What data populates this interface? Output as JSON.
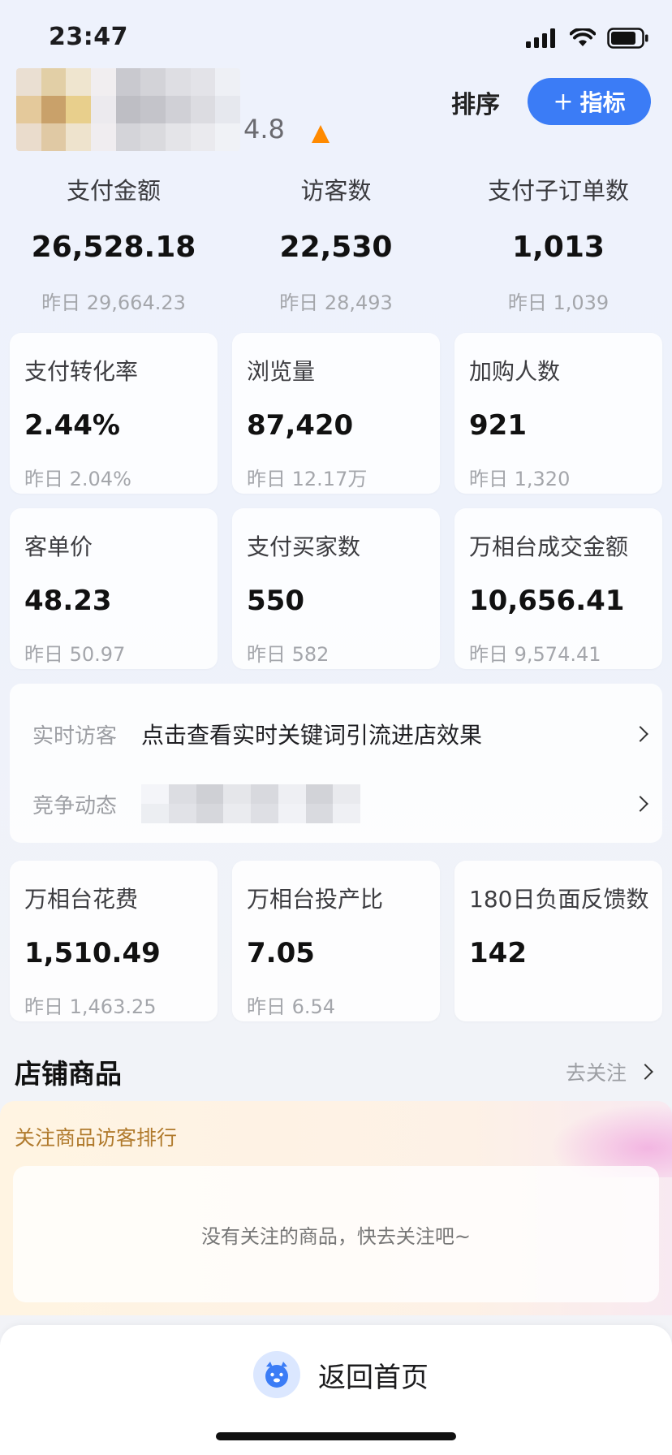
{
  "status_bar": {
    "time": "23:47"
  },
  "header": {
    "rating_suffix": "4.8",
    "sort_label": "排序",
    "metric_label": "指标"
  },
  "top_metrics": [
    {
      "label": "支付金额",
      "value": "26,528.18",
      "prev": "昨日 29,664.23"
    },
    {
      "label": "访客数",
      "value": "22,530",
      "prev": "昨日 28,493"
    },
    {
      "label": "支付子订单数",
      "value": "1,013",
      "prev": "昨日 1,039"
    }
  ],
  "cards": [
    {
      "label": "支付转化率",
      "value": "2.44%",
      "prev": "昨日 2.04%"
    },
    {
      "label": "浏览量",
      "value": "87,420",
      "prev": "昨日 12.17万"
    },
    {
      "label": "加购人数",
      "value": "921",
      "prev": "昨日 1,320"
    },
    {
      "label": "客单价",
      "value": "48.23",
      "prev": "昨日 50.97"
    },
    {
      "label": "支付买家数",
      "value": "550",
      "prev": "昨日 582"
    },
    {
      "label": "万相台成交金额",
      "value": "10,656.41",
      "prev": "昨日 9,574.41"
    },
    {
      "label": "万相台花费",
      "value": "1,510.49",
      "prev": "昨日 1,463.25"
    },
    {
      "label": "万相台投产比",
      "value": "7.05",
      "prev": "昨日 6.54"
    },
    {
      "label": "180日负面反馈数",
      "value": "142",
      "prev": ""
    }
  ],
  "info_panel": {
    "realtime_label": "实时访客",
    "realtime_text": "点击查看实时关键词引流进店效果",
    "competition_label": "竞争动态"
  },
  "store_products": {
    "title": "店铺商品",
    "follow_link": "去关注",
    "ranking_title": "关注商品访客排行",
    "empty_text": "没有关注的商品，快去关注吧~"
  },
  "bottom": {
    "home_label": "返回首页"
  },
  "colors": {
    "accent": "#3b7cf6",
    "rating_arrow": "#ff8a00"
  }
}
